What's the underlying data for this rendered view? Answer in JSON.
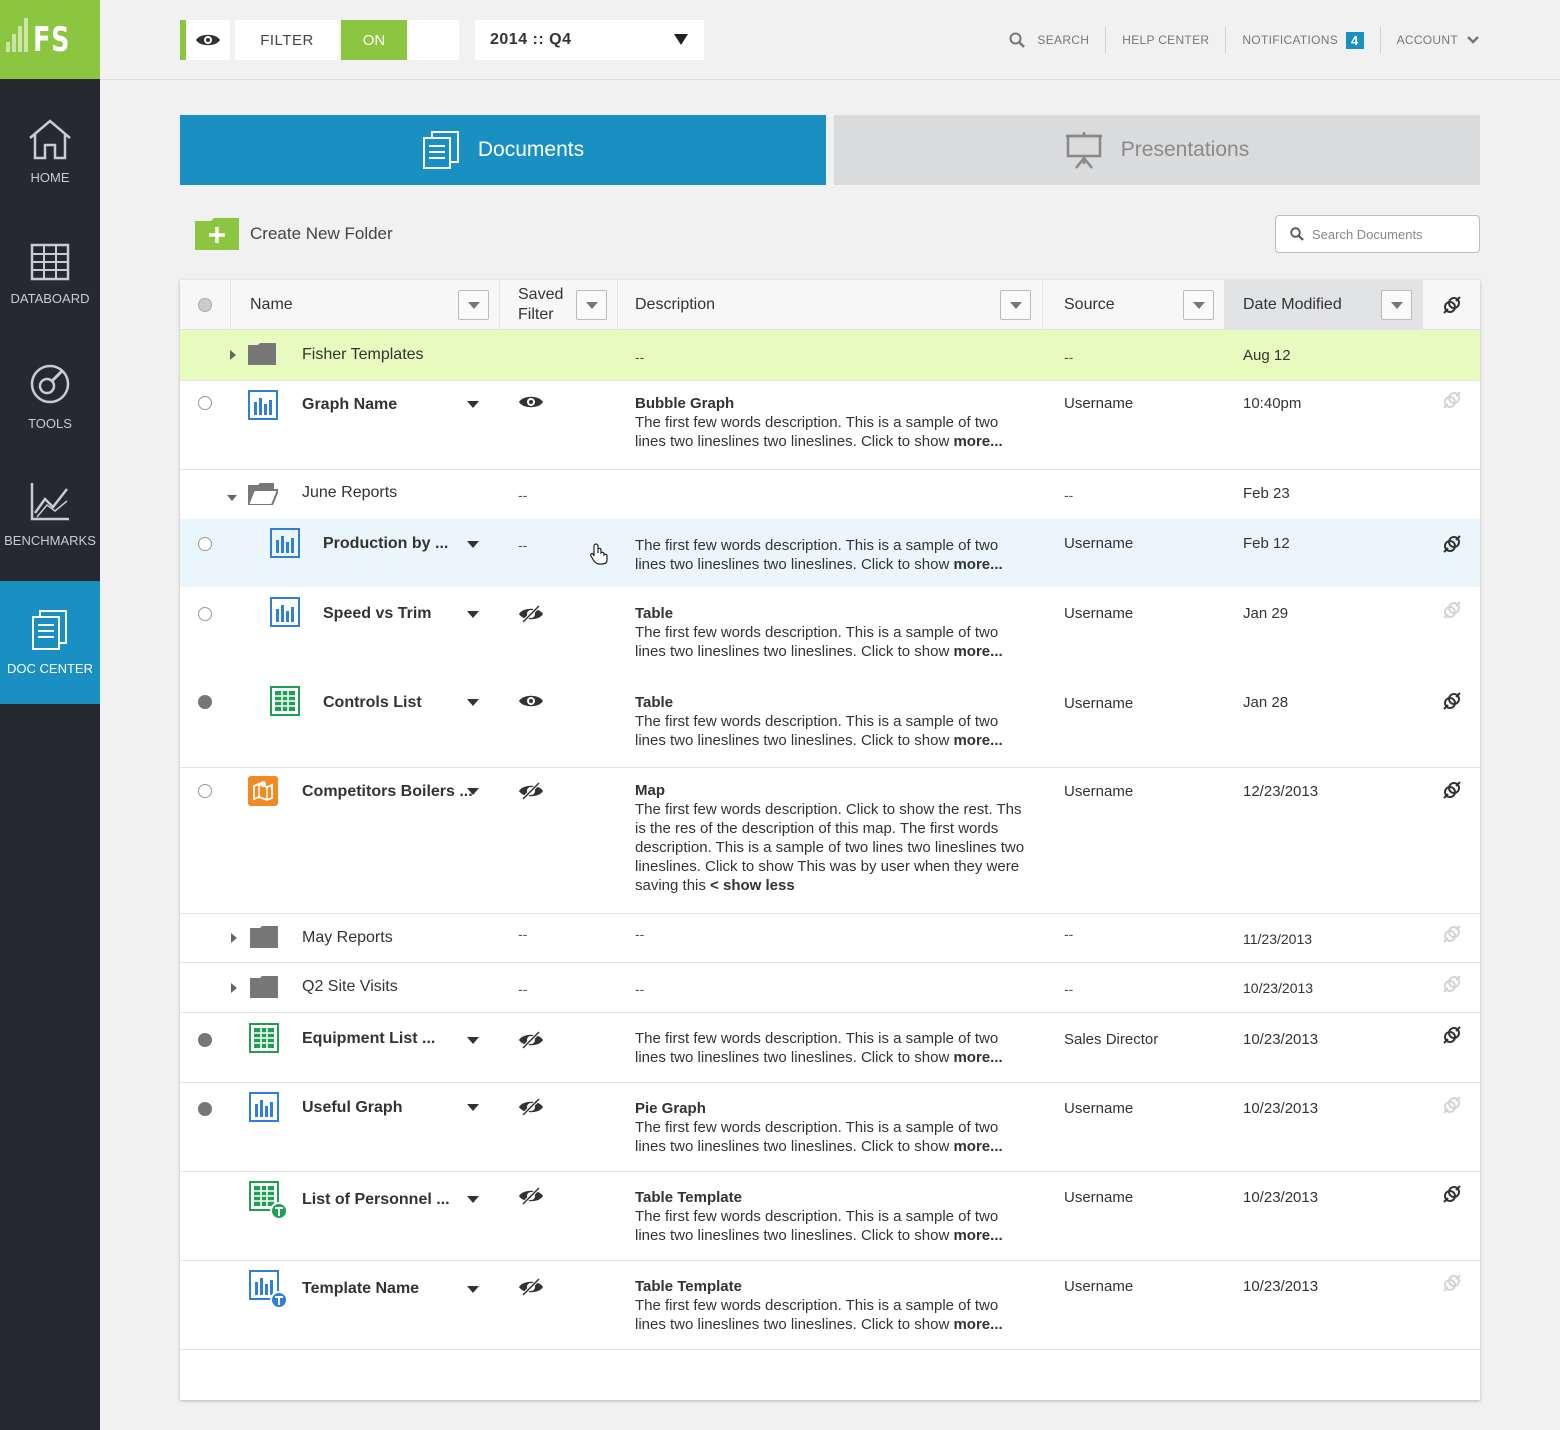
{
  "logo": {
    "text": "FS"
  },
  "sidebar": {
    "items": [
      {
        "label": "HOME",
        "icon": "home-icon"
      },
      {
        "label": "DATABOARD",
        "icon": "grid-icon"
      },
      {
        "label": "TOOLS",
        "icon": "tools-icon"
      },
      {
        "label": "BENCHMARKS",
        "icon": "chart-icon"
      },
      {
        "label": "DOC CENTER",
        "icon": "document-icon",
        "active": true
      }
    ]
  },
  "topbar": {
    "filter_label": "FILTER",
    "toggle_label": "ON",
    "period": "2014 :: Q4",
    "search": "SEARCH",
    "help": "HELP CENTER",
    "notifications": "NOTIFICATIONS",
    "notifications_count": "4",
    "account": "ACCOUNT"
  },
  "tabs": {
    "documents": "Documents",
    "presentations": "Presentations"
  },
  "toolbar": {
    "create_folder": "Create New Folder",
    "search_placeholder": "Search Documents"
  },
  "columns": {
    "name": "Name",
    "saved_filter_1": "Saved",
    "saved_filter_2": "Filter",
    "description": "Description",
    "source": "Source",
    "date_modified": "Date Modified"
  },
  "rows": [
    {
      "name": "Fisher Templates",
      "desc": "--",
      "source": "--",
      "date": "Aug 12"
    },
    {
      "name": "Graph Name",
      "desc_title": "Bubble Graph",
      "desc": "The first few words description. This is a sample of two lines two lineslines two lineslines. Click to show",
      "more": "more...",
      "source": "Username",
      "date": "10:40pm"
    },
    {
      "name": "June Reports",
      "filter": "--",
      "source": "--",
      "date": "Feb 23"
    },
    {
      "name": "Production by ...",
      "filter": "--",
      "desc": "The first few words description. This is a sample of two lines two lineslines two lineslines. Click to show",
      "more": "more...",
      "source": "Username",
      "date": "Feb 12"
    },
    {
      "name": "Speed vs Trim",
      "desc_title": "Table",
      "desc": "The first few words description. This is a sample of two lines two lineslines two lineslines. Click to show",
      "more": "more...",
      "source": "Username",
      "date": "Jan 29"
    },
    {
      "name": "Controls List",
      "desc_title": "Table",
      "desc": "The first few words description. This is a sample of two lines two lineslines two lineslines. Click to show",
      "more": "more...",
      "source": "Username",
      "date": "Jan 28"
    },
    {
      "name": "Competitors Boilers ...",
      "desc_title": "Map",
      "desc": "The first few words description. Click to show the rest. Ths is the res of the description of this map. The first words description. This is a sample of two lines two lineslines two lineslines. Click to show  This was by user when they were saving this",
      "more": "< show less",
      "source": "Username",
      "date": "12/23/2013"
    },
    {
      "name": "May Reports",
      "filter": "--",
      "desc": "--",
      "source": "--",
      "date": "11/23/2013"
    },
    {
      "name": "Q2 Site Visits",
      "filter": "--",
      "desc": "--",
      "source": "--",
      "date": "10/23/2013"
    },
    {
      "name": "Equipment List ...",
      "desc": "The first few words description. This is a sample of two lines two lineslines two lineslines. Click to show",
      "more": "more...",
      "source": "Sales Director",
      "date": "10/23/2013"
    },
    {
      "name": "Useful Graph",
      "desc_title": "Pie Graph",
      "desc": "The first few words description. This is a sample of two lines two lineslines two lineslines. Click to show",
      "more": "more...",
      "source": "Username",
      "date": "10/23/2013"
    },
    {
      "name": "List of Personnel ...",
      "desc_title": "Table Template",
      "desc": "The first few words description. This is a sample of two lines two lineslines two lineslines. Click to show",
      "more": "more...",
      "source": "Username",
      "date": "10/23/2013"
    },
    {
      "name": "Template Name",
      "desc_title": "Table Template",
      "desc": "The first few words description. This is a sample of two lines two lineslines two lineslines. Click to show",
      "more": "more...",
      "source": "Username",
      "date": "10/23/2013"
    }
  ],
  "colors": {
    "brand_green": "#8cc53f",
    "accent_blue": "#1a8fc1",
    "sidebar_bg": "#262a30",
    "row_green": "#e6fbbd",
    "row_blue": "#eaf6fb"
  }
}
